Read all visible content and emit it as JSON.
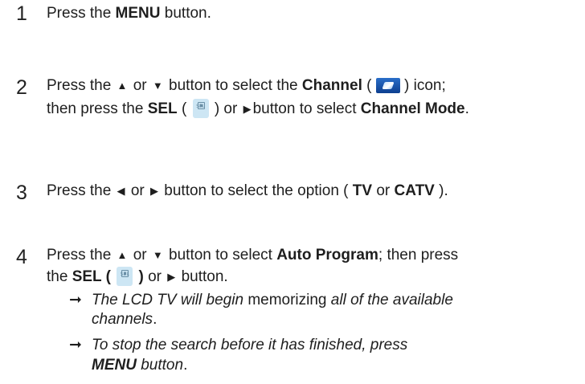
{
  "steps": [
    {
      "number": "1",
      "press": "Press the ",
      "menu": "MENU",
      "button": " button."
    },
    {
      "number": "2",
      "press": "Press the",
      "or": "or",
      "button_to_select": "button to select the",
      "channel": "Channel",
      "paren_open": "(",
      "paren_close": ") icon;",
      "then_press_the": "then press the",
      "sel": "SEL",
      "sel_paren_open": "(",
      "sel_paren_close": ") or",
      "button_to_select_2": "button to select",
      "channel_mode": "Channel Mode",
      "period": "."
    },
    {
      "number": "3",
      "press": "Press the",
      "or": "or",
      "button_to_select": "button to select the option (",
      "tv": "TV",
      "or2": "or",
      "catv": "CATV",
      "close": ")."
    },
    {
      "number": "4",
      "press": "Press the",
      "or": "or",
      "button_to_select": "button to select",
      "auto_program": "Auto Program",
      "then_press": "; then press",
      "the": "the",
      "sel": "SEL (",
      "sel_close": ")",
      "or2": "or",
      "button": "button.",
      "notes": [
        {
          "a": "The LCD TV will begin",
          "b": "memorizing",
          "c": "all of the available",
          "d": "channels",
          "e": "."
        },
        {
          "a": "To stop the search before it has finished, press",
          "b": "MENU",
          "c": "button",
          "d": "."
        }
      ]
    }
  ],
  "icons": {
    "channel": "channel-icon",
    "sel": "sel-button-icon",
    "sel_label": "SEL",
    "up": "▲",
    "down": "▼",
    "left": "◀",
    "right": "▶",
    "arrow": "➞"
  }
}
